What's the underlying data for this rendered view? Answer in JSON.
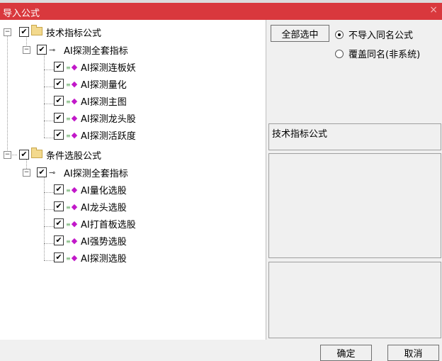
{
  "window": {
    "title": "导入公式",
    "close_glyph": "×"
  },
  "tree": {
    "groups": [
      {
        "label": "技术指标公式",
        "checked": true,
        "child": {
          "label": "AI探测全套指标",
          "checked": true,
          "items": [
            "AI探测连板妖",
            "AI探测量化",
            "AI探测主图",
            "AI探测龙头股",
            "AI探测活跃度"
          ]
        }
      },
      {
        "label": "条件选股公式",
        "checked": true,
        "child": {
          "label": "AI探测全套指标",
          "checked": true,
          "items": [
            "AI量化选股",
            "AI龙头选股",
            "AI打首板选股",
            "AI强势选股",
            "AI探测选股"
          ]
        }
      }
    ]
  },
  "options": {
    "select_all_label": "全部选中",
    "radio_skip": "不导入同名公式",
    "radio_overwrite": "覆盖同名(非系统)",
    "selected_radio": "skip"
  },
  "info": {
    "category": "技术指标公式"
  },
  "buttons": {
    "ok": "确定",
    "cancel": "取消"
  },
  "glyphs": {
    "minus": "−",
    "check": "✔",
    "key": "⊸",
    "diamond": "◆",
    "dots": "≡"
  },
  "colors": {
    "titlebar": "#d9383d",
    "item_icon": "#c218c9",
    "folder": "#f3d98d"
  }
}
